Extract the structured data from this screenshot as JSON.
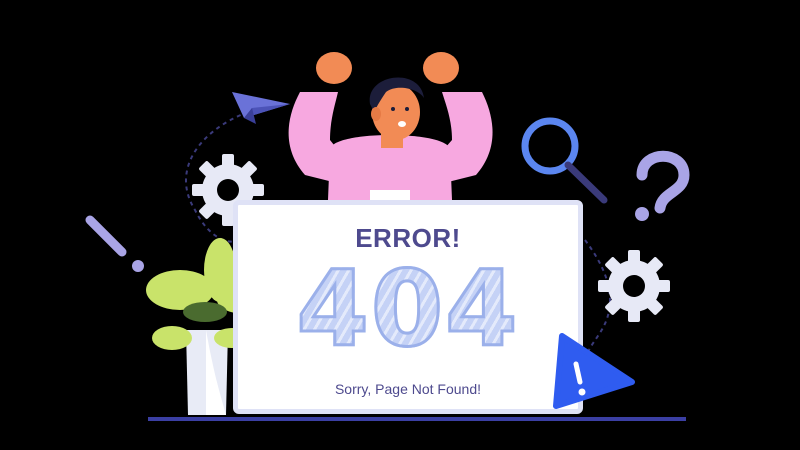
{
  "error_title": "ERROR!",
  "error_code": "404",
  "error_message": "Sorry, Page Not Found!",
  "colors": {
    "accent": "#4e4a8e",
    "code_fill": "#b9c8f2",
    "warning": "#2f5cf0",
    "sweater": "#f7a8e0",
    "leaf": "#c9e36a"
  },
  "icons": [
    "paper-plane-icon",
    "gear-icon",
    "magnifier-icon",
    "question-mark-icon",
    "exclamation-icon",
    "warning-triangle-icon",
    "potted-plant-icon"
  ]
}
